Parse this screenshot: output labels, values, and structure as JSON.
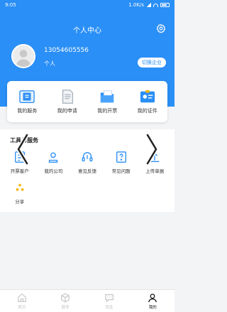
{
  "status_bar": {
    "time": "9:05",
    "network_speed": "1.0K/s"
  },
  "header": {
    "title": "个人中心",
    "settings_icon": "gear-icon"
  },
  "profile": {
    "phone": "13054605556",
    "role": "个人",
    "switch_button": "切换企业"
  },
  "quick_actions": [
    {
      "label": "我的服务",
      "icon": "service-icon"
    },
    {
      "label": "我的申请",
      "icon": "application-icon"
    },
    {
      "label": "我的开票",
      "icon": "invoice-folder-icon"
    },
    {
      "label": "我的证件",
      "icon": "id-card-icon"
    }
  ],
  "tools": {
    "title": "工具与服务",
    "items": [
      {
        "label": "开票客户",
        "icon": "customer-icon"
      },
      {
        "label": "我的公司",
        "icon": "company-icon"
      },
      {
        "label": "意见反馈",
        "icon": "feedback-icon"
      },
      {
        "label": "常见问题",
        "icon": "faq-icon"
      },
      {
        "label": "上传单据",
        "icon": "upload-icon"
      },
      {
        "label": "分享",
        "icon": "share-icon"
      }
    ]
  },
  "tabbar": [
    {
      "label": "首页",
      "icon": "home-icon",
      "active": false
    },
    {
      "label": "服务",
      "icon": "box-icon",
      "active": false
    },
    {
      "label": "消息",
      "icon": "message-icon",
      "active": false
    },
    {
      "label": "我的",
      "icon": "user-icon",
      "active": true
    }
  ],
  "colors": {
    "primary": "#2a8ff6",
    "accent_yellow": "#f5b400",
    "tab_active": "#111111",
    "tab_inactive": "#c6c6c6"
  }
}
